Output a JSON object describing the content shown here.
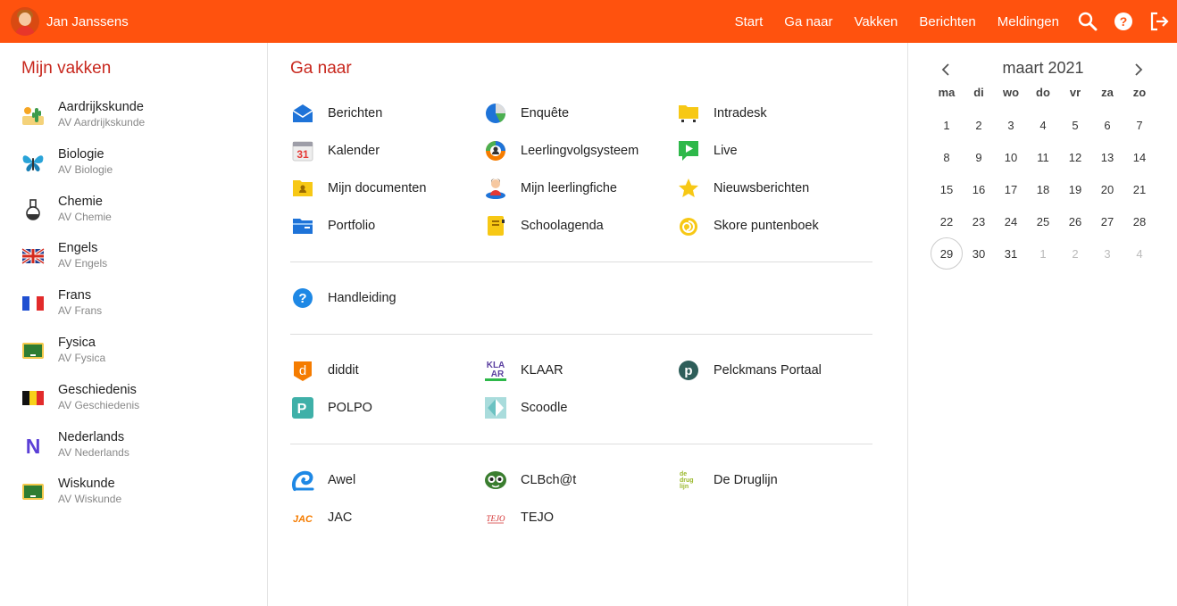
{
  "user": {
    "name": "Jan Janssens"
  },
  "nav": [
    "Start",
    "Ga naar",
    "Vakken",
    "Berichten",
    "Meldingen"
  ],
  "top_icons": [
    "search-icon",
    "help-icon",
    "logout-icon"
  ],
  "courses_title": "Mijn vakken",
  "courses": [
    {
      "name": "Aardrijkskunde",
      "sub": "AV Aardrijkskunde",
      "icon": "cactus-landscape-icon"
    },
    {
      "name": "Biologie",
      "sub": "AV Biologie",
      "icon": "butterfly-icon"
    },
    {
      "name": "Chemie",
      "sub": "AV Chemie",
      "icon": "flask-icon"
    },
    {
      "name": "Engels",
      "sub": "AV Engels",
      "icon": "uk-flag-icon"
    },
    {
      "name": "Frans",
      "sub": "AV Frans",
      "icon": "french-flag-icon"
    },
    {
      "name": "Fysica",
      "sub": "AV Fysica",
      "icon": "chalkboard-icon"
    },
    {
      "name": "Geschiedenis",
      "sub": "AV Geschiedenis",
      "icon": "belgian-flag-icon"
    },
    {
      "name": "Nederlands",
      "sub": "AV Nederlands",
      "icon": "letter-n-icon",
      "icon_text": "N"
    },
    {
      "name": "Wiskunde",
      "sub": "AV Wiskunde",
      "icon": "chalkboard-icon"
    }
  ],
  "goto_title": "Ga naar",
  "groups": [
    [
      {
        "name": "Berichten",
        "icon": "mail-icon"
      },
      {
        "name": "Enquête",
        "icon": "pie-chart-icon"
      },
      {
        "name": "Intradesk",
        "icon": "folder-icon"
      },
      {
        "name": "Kalender",
        "icon": "calendar-icon",
        "icon_text": "31"
      },
      {
        "name": "Leerlingvolgsysteem",
        "icon": "student-tracking-icon"
      },
      {
        "name": "Live",
        "icon": "live-video-icon"
      },
      {
        "name": "Mijn documenten",
        "icon": "documents-folder-icon"
      },
      {
        "name": "Mijn leerlingfiche",
        "icon": "student-card-icon"
      },
      {
        "name": "Nieuwsberichten",
        "icon": "star-icon"
      },
      {
        "name": "Portfolio",
        "icon": "portfolio-folder-icon"
      },
      {
        "name": "Schoolagenda",
        "icon": "agenda-icon"
      },
      {
        "name": "Skore puntenboek",
        "icon": "skore-icon"
      }
    ],
    [
      {
        "name": "Handleiding",
        "icon": "help-circle-icon"
      }
    ],
    [
      {
        "name": "diddit",
        "icon": "diddit-icon",
        "icon_text": "d"
      },
      {
        "name": "KLAAR",
        "icon": "klaar-icon",
        "icon_text": "KLA AR"
      },
      {
        "name": "Pelckmans Portaal",
        "icon": "pelckmans-icon",
        "icon_text": "p"
      },
      {
        "name": "POLPO",
        "icon": "polpo-icon",
        "icon_text": "P"
      },
      {
        "name": "Scoodle",
        "icon": "scoodle-icon"
      }
    ],
    [
      {
        "name": "Awel",
        "icon": "awel-icon"
      },
      {
        "name": "CLBch@t",
        "icon": "clbchat-icon"
      },
      {
        "name": "De Druglijn",
        "icon": "druglijn-icon",
        "icon_text": "de drug lijn"
      },
      {
        "name": "JAC",
        "icon": "jac-icon",
        "icon_text": "JAC"
      },
      {
        "name": "TEJO",
        "icon": "tejo-icon",
        "icon_text": "TEJO"
      }
    ]
  ],
  "calendar": {
    "title": "maart 2021",
    "weekdays": [
      "ma",
      "di",
      "wo",
      "do",
      "vr",
      "za",
      "zo"
    ],
    "days": [
      {
        "d": "1"
      },
      {
        "d": "2"
      },
      {
        "d": "3"
      },
      {
        "d": "4"
      },
      {
        "d": "5"
      },
      {
        "d": "6"
      },
      {
        "d": "7"
      },
      {
        "d": "8"
      },
      {
        "d": "9"
      },
      {
        "d": "10"
      },
      {
        "d": "11"
      },
      {
        "d": "12"
      },
      {
        "d": "13"
      },
      {
        "d": "14"
      },
      {
        "d": "15"
      },
      {
        "d": "16"
      },
      {
        "d": "17"
      },
      {
        "d": "18"
      },
      {
        "d": "19"
      },
      {
        "d": "20"
      },
      {
        "d": "21"
      },
      {
        "d": "22"
      },
      {
        "d": "23"
      },
      {
        "d": "24"
      },
      {
        "d": "25"
      },
      {
        "d": "26"
      },
      {
        "d": "27"
      },
      {
        "d": "28"
      },
      {
        "d": "29",
        "today": true
      },
      {
        "d": "30"
      },
      {
        "d": "31"
      },
      {
        "d": "1",
        "muted": true
      },
      {
        "d": "2",
        "muted": true
      },
      {
        "d": "3",
        "muted": true
      },
      {
        "d": "4",
        "muted": true
      }
    ]
  },
  "colors": {
    "brand": "#ff520e",
    "title": "#c8281e"
  }
}
